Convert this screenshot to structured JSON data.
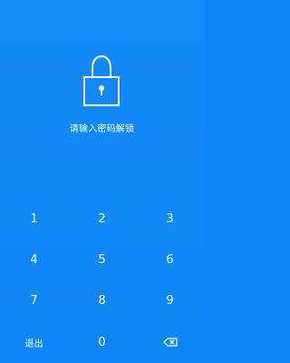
{
  "prompt": "请输入密码解锁",
  "keypad": {
    "keys": [
      {
        "label": "1"
      },
      {
        "label": "2"
      },
      {
        "label": "3"
      },
      {
        "label": "4"
      },
      {
        "label": "5"
      },
      {
        "label": "6"
      },
      {
        "label": "7"
      },
      {
        "label": "8"
      },
      {
        "label": "9"
      },
      {
        "label": "退出"
      },
      {
        "label": "0"
      },
      {
        "label": "",
        "icon": "backspace-icon"
      }
    ]
  },
  "colors": {
    "background": "#0f86f5",
    "foreground": "#ffffff"
  },
  "icons": {
    "lock": "lock-icon",
    "backspace": "backspace-icon"
  }
}
